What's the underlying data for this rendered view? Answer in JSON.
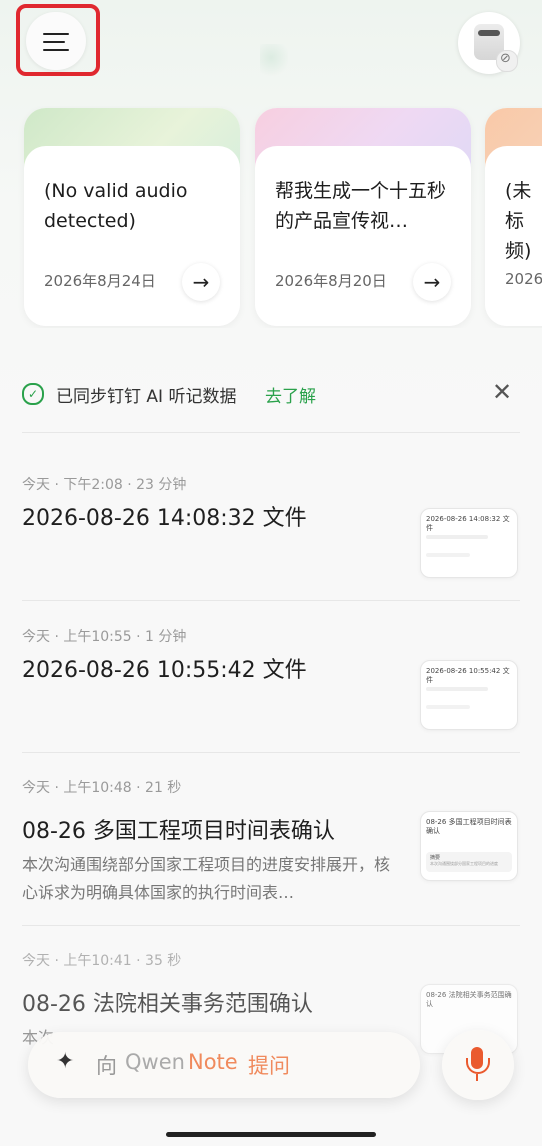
{
  "colors": {
    "accent_green": "#2aa14b",
    "accent_orange": "#f08a5d",
    "highlight_red": "#e0282f"
  },
  "header": {
    "menu_icon": "hamburger-menu-icon",
    "device_icon": "recorder-device-icon",
    "device_status_icon": "disconnected-icon"
  },
  "recent_cards": [
    {
      "title": "(No valid audio detected)",
      "date": "2026年8月24日",
      "arrow": "→"
    },
    {
      "title": "帮我生成一个十五秒的产品宣传视…",
      "date": "2026年8月20日",
      "arrow": "→"
    },
    {
      "title": "(未标频)",
      "date": "2026"
    }
  ],
  "sync_banner": {
    "text": "已同步钉钉 AI 听记数据",
    "link": "去了解",
    "check": "✓",
    "close": "✕"
  },
  "recordings": [
    {
      "meta": "今天 · 下午2:08 · 23 分钟",
      "title": "2026-08-26 14:08:32 文件",
      "thumb_title": "2026-08-26 14:08:32 文件"
    },
    {
      "meta": "今天 · 上午10:55 · 1 分钟",
      "title": "2026-08-26 10:55:42 文件",
      "thumb_title": "2026-08-26 10:55:42 文件"
    },
    {
      "meta": "今天 · 上午10:48 · 21 秒",
      "title": "08-26 多国工程项目时间表确认",
      "desc": "本次沟通围绕部分国家工程项目的进度安排展开，核心诉求为明确具体国家的执行时间表…",
      "thumb_title": "08-26 多国工程项目时间表确认",
      "thumb_box_label": "摘要",
      "thumb_box_text": "本次沟通围绕部分国家工程项目的进度"
    },
    {
      "meta": "今天 · 上午10:41 · 35 秒",
      "title": "08-26 法院相关事务范围确认",
      "desc": "本次",
      "thumb_title": "08-26 法院相关事务范围确认"
    }
  ],
  "ask_bar": {
    "prefix": "向",
    "brand_a": "Qwen",
    "brand_b": "Note",
    "suffix": "提问",
    "sparkle_icon": "✦"
  }
}
